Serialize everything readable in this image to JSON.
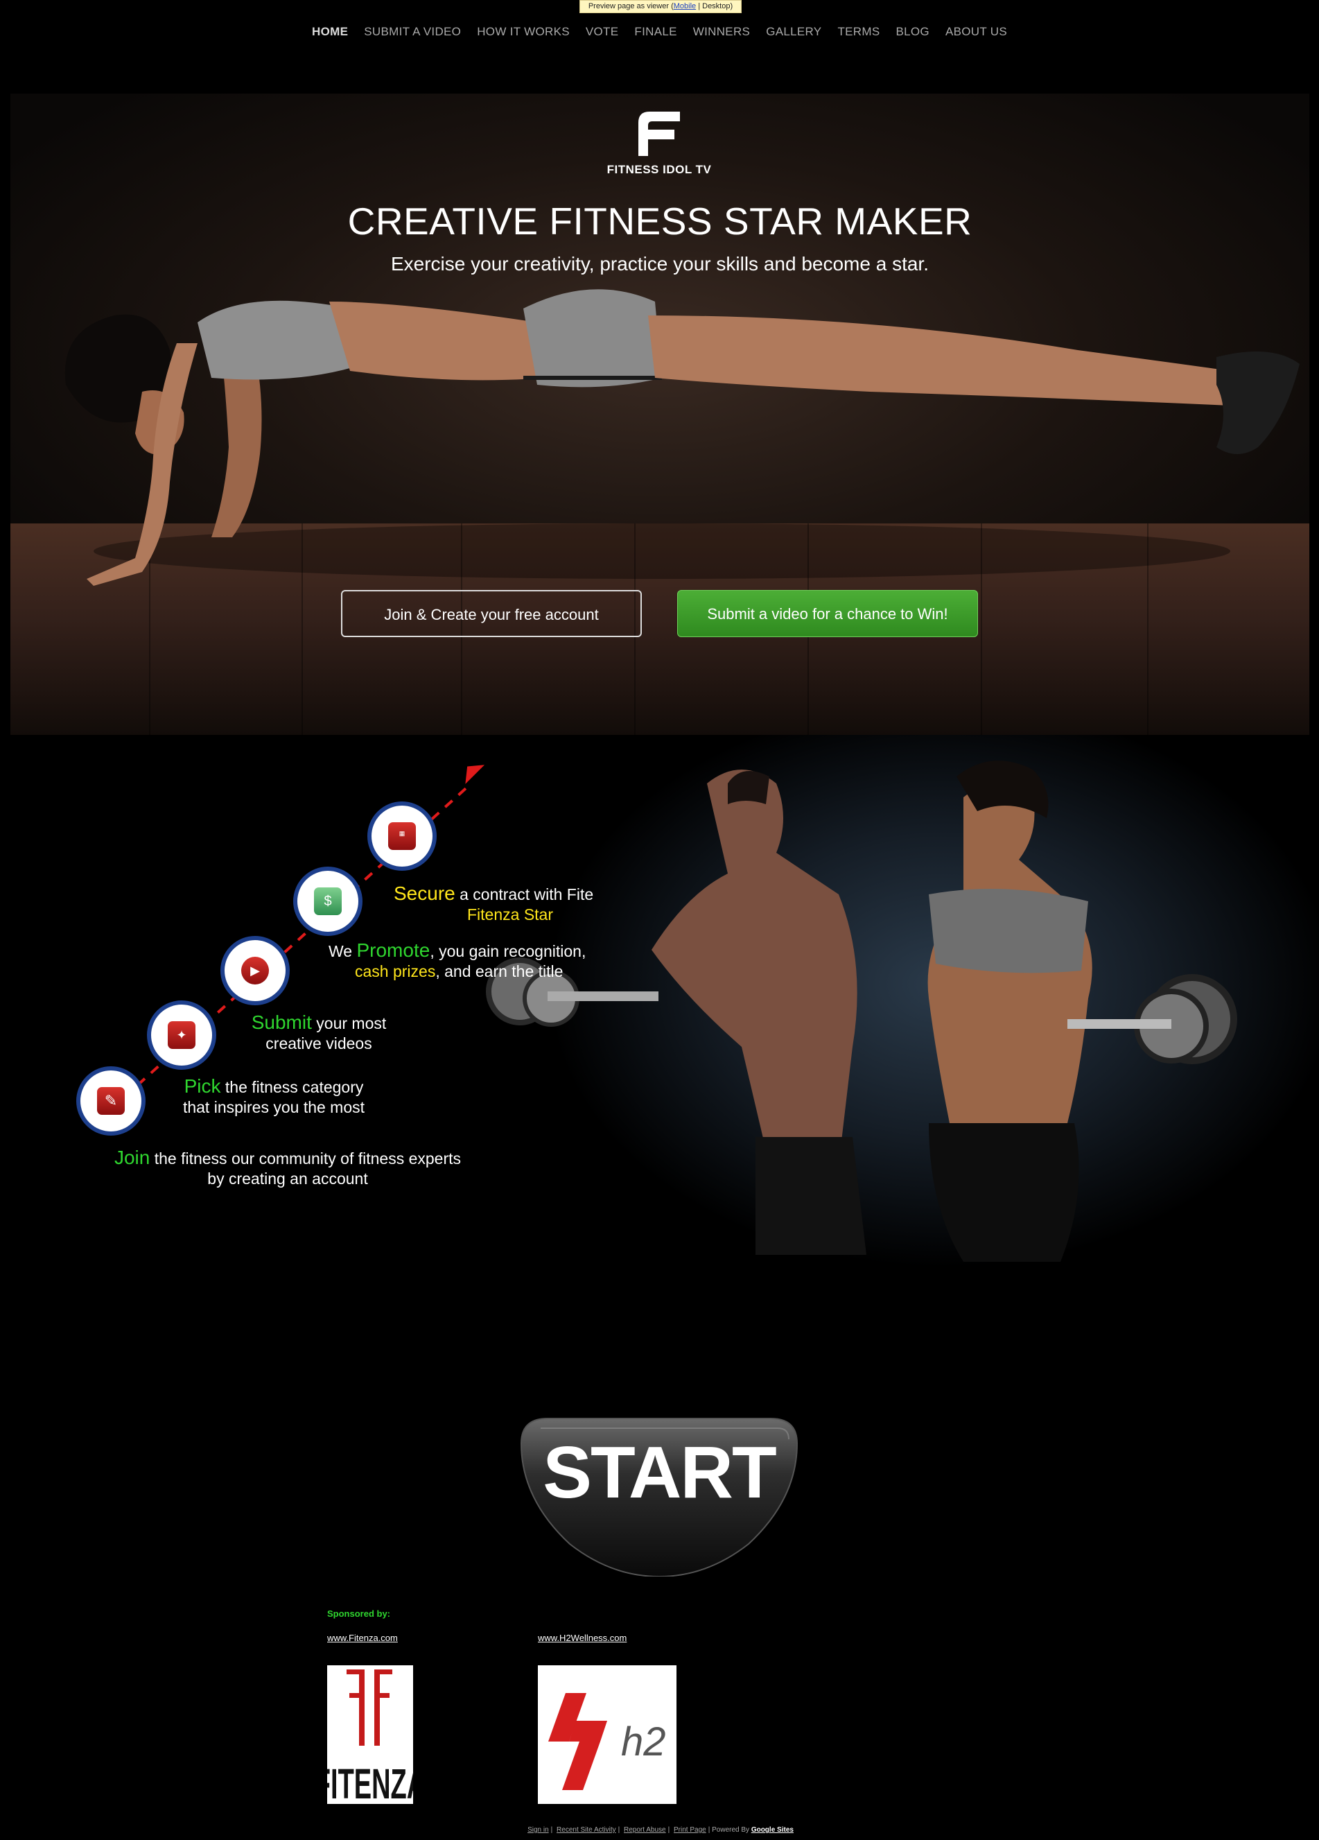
{
  "preview_bar": {
    "prefix": "Preview page as viewer (",
    "mobile": "Mobile",
    "sep": " | ",
    "desktop": "Desktop",
    "suffix": ")"
  },
  "nav": {
    "items": [
      "HOME",
      "SUBMIT A VIDEO",
      "HOW IT WORKS",
      "VOTE",
      "FINALE",
      "WINNERS",
      "GALLERY",
      "TERMS",
      "BLOG",
      "ABOUT US"
    ]
  },
  "hero": {
    "brand": "FITNESS IDOL TV",
    "title": "CREATIVE FITNESS STAR MAKER",
    "subtitle": "Exercise your creativity, practice your skills and become a star.",
    "join_button": "Join & Create your free account",
    "submit_button": "Submit a video for a chance to Win!"
  },
  "steps": {
    "secure": {
      "keyword": "Secure",
      "rest": " a contract with Fite",
      "line2": "Fitenza Star"
    },
    "promote": {
      "pre": "We ",
      "keyword": "Promote",
      "rest": ", you gain recognition,",
      "line2_highlight": "cash prizes",
      "line2_rest": ", and earn the title"
    },
    "submit": {
      "keyword": "Submit",
      "rest": " your most",
      "line2": "creative videos"
    },
    "pick": {
      "keyword": "Pick",
      "rest": " the fitness category",
      "line2": "that inspires you the most"
    },
    "join": {
      "keyword": "Join",
      "rest": " the fitness our community of fitness experts",
      "line2": "by creating an account"
    },
    "contract_icon_text": "CONTRACT"
  },
  "start_button": "START",
  "sponsors": {
    "label": "Sponsored by:",
    "items": [
      {
        "link": "www.Fitenza.com",
        "logo_text": "FITENZA"
      },
      {
        "link": "www.H2Wellness.com",
        "logo_text": "h2"
      }
    ]
  },
  "footer": {
    "links": [
      "Sign in",
      "Recent Site Activity",
      "Report Abuse",
      "Print Page"
    ],
    "powered_by": "Powered By",
    "google_sites": "Google Sites"
  },
  "colors": {
    "accent_green": "#2fd62f",
    "accent_yellow": "#ffe61b",
    "step_ring": "#1d3f8c",
    "icon_red": "#c81e1e"
  }
}
